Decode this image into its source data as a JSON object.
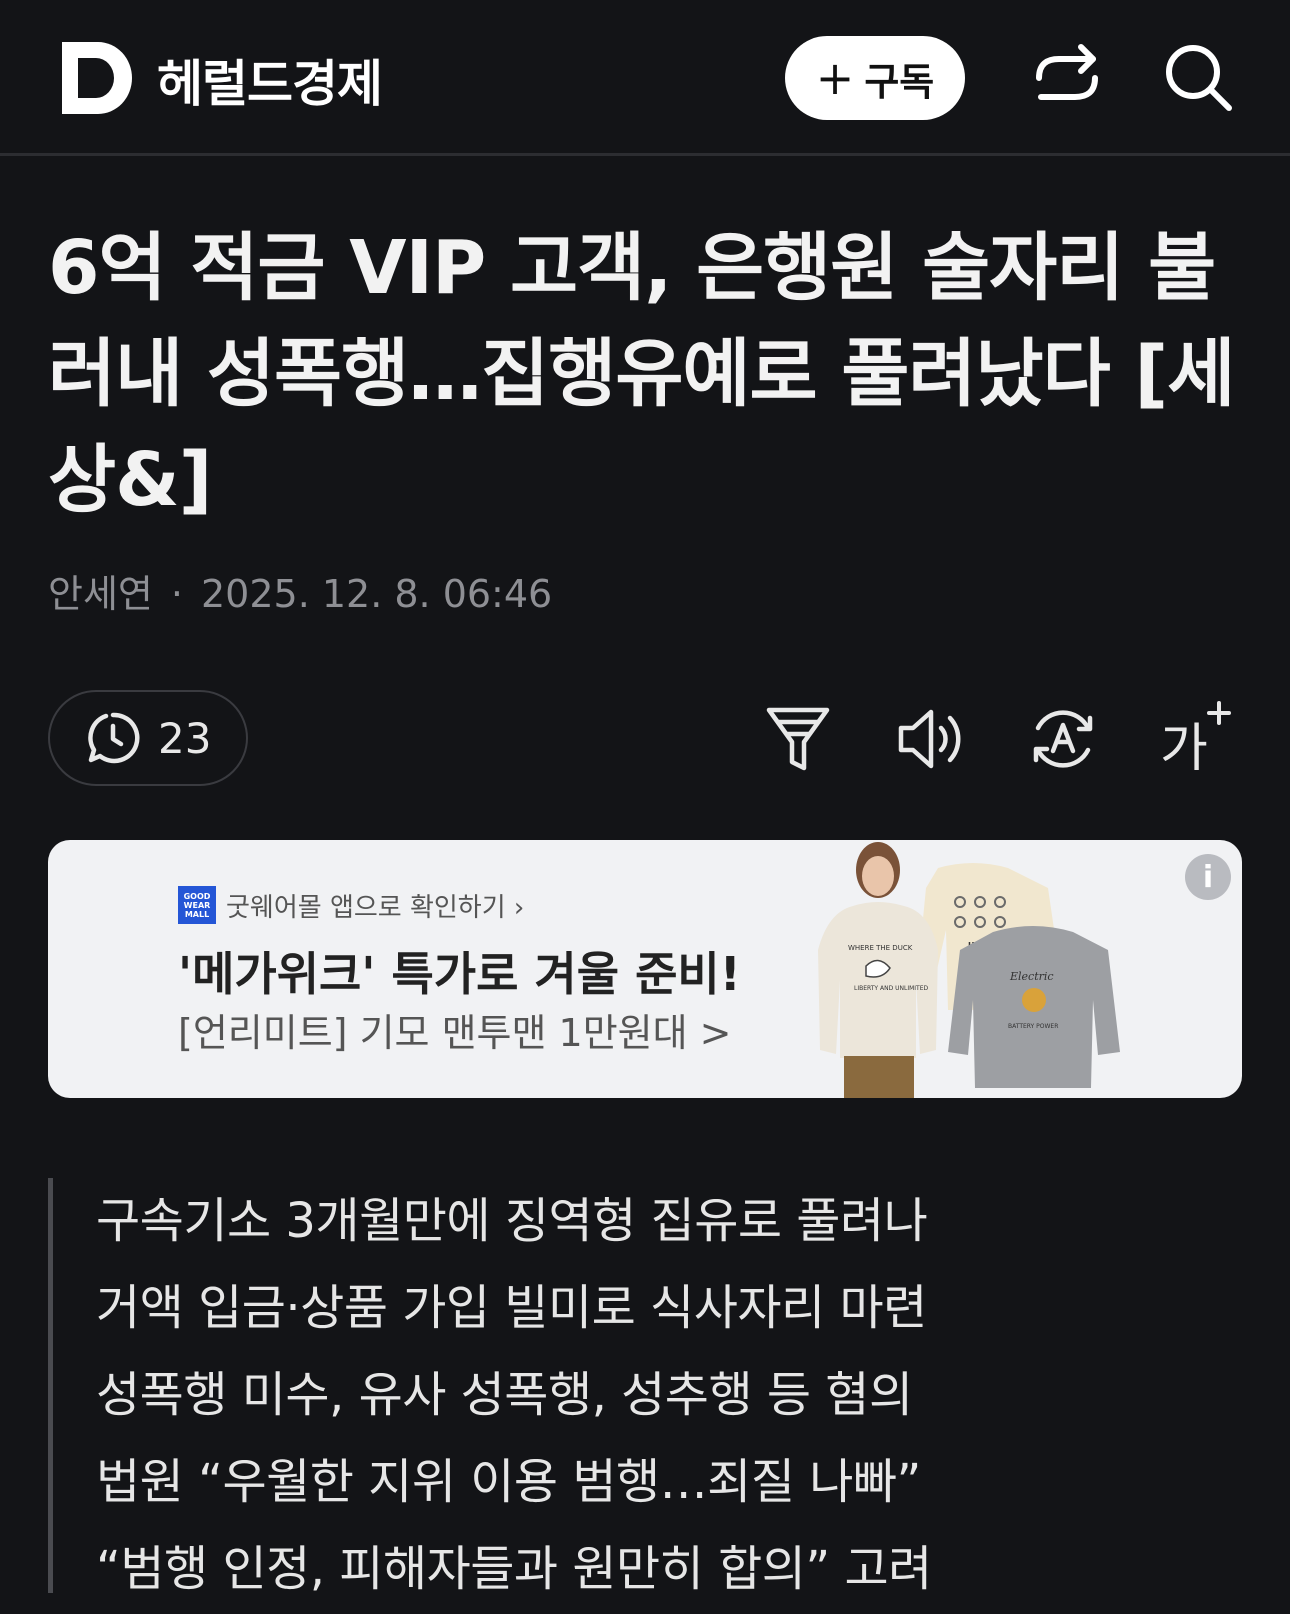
{
  "header": {
    "logo_letter": "D",
    "brand": "헤럴드경제",
    "subscribe_plus": "+",
    "subscribe_label": "구독",
    "share_icon": "share-icon",
    "search_icon": "search-icon"
  },
  "article": {
    "title": "6억 적금 VIP 고객, 은행원 술자리 불러내 성폭행…집행유예로 풀려났다 [세상&]",
    "author": "안세연",
    "separator": "·",
    "date": "2025. 12. 8. 06:46"
  },
  "toolbar": {
    "comment_count": "23",
    "icons": [
      "comment-icon",
      "filter-icon",
      "speaker-icon",
      "translate-icon",
      "font-size-icon"
    ],
    "font_size_label": "가"
  },
  "ad": {
    "brand_logo_lines": [
      "GOOD",
      "WEAR",
      "MALL"
    ],
    "brand_link": "굿웨어몰 앱으로 확인하기 ›",
    "headline": "'메가위크' 특가로 겨울 준비!",
    "subline": "[언리미트] 기모 맨투맨 1만원대 >",
    "info_label": "i",
    "product_prints": [
      "WHERE THE DUCK",
      "LIBERTY AND UNLIMITED",
      "ULTD.",
      "Electric",
      "BATTERY POWER"
    ]
  },
  "summary": [
    "구속기소 3개월만에 징역형 집유로 풀려나",
    "거액 입금·상품 가입 빌미로 식사자리 마련",
    "성폭행 미수, 유사 성폭행, 성추행 등 혐의",
    "법원 “우월한 지위 이용 범행…죄질 나빠”",
    "“범행 인정, 피해자들과 원만히 합의” 고려"
  ],
  "colors": {
    "background": "#131417",
    "text": "#f2f2f2",
    "meta": "#8e8f94",
    "ad_background": "#f1f2f4",
    "brand_blue": "#2456d6"
  }
}
